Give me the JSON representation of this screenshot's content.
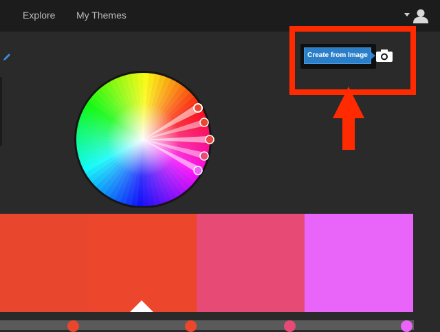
{
  "nav": {
    "explore_label": "Explore",
    "my_themes_label": "My Themes"
  },
  "toolbar": {
    "create_from_image_label": "Create from Image",
    "camera_icon": "camera-icon",
    "edit_icon": "pencil-icon"
  },
  "annotation": {
    "highlight_color": "#ff2a00"
  },
  "theme": {
    "colors": [
      "#e8472e",
      "#ec472c",
      "#e84a76",
      "#e964f8"
    ],
    "selected_index": 1
  },
  "wheel": {
    "handle_colors": [
      "#ec472c",
      "#e8472e",
      "#ea4a3d",
      "#e84a76",
      "#e964f8"
    ]
  }
}
